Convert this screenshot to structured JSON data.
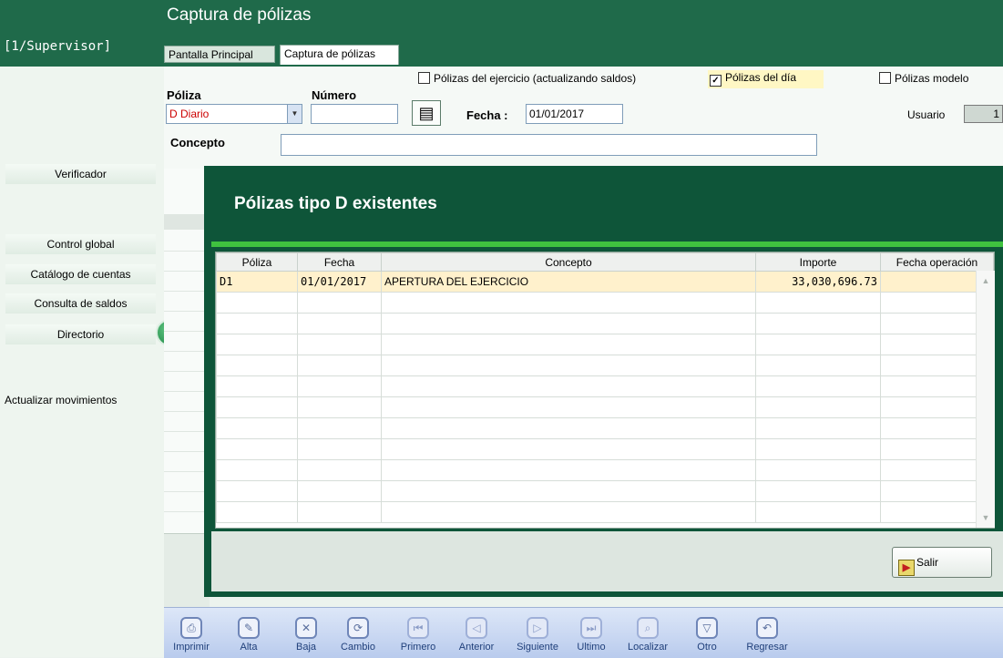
{
  "header": {
    "title": "Captura de pólizas",
    "user_tag": "[1/Supervisor]",
    "tabs": [
      "Pantalla Principal",
      "Captura de pólizas"
    ]
  },
  "sidebar": {
    "items": [
      "Verificador",
      "Control global",
      "Catálogo de cuentas",
      "Consulta de saldos",
      "Directorio"
    ],
    "actualizar_label": "Actualizar movimientos"
  },
  "form": {
    "chk_ejercicio": "Pólizas del ejercicio (actualizando saldos)",
    "chk_dia": "Pólizas del día",
    "chk_dia_checked": true,
    "chk_modelo": "Pólizas modelo",
    "poliza_label": "Póliza",
    "poliza_value": "D Diario",
    "numero_label": "Número",
    "numero_value": "",
    "fecha_label": "Fecha :",
    "fecha_value": "01/01/2017",
    "usuario_label": "Usuario",
    "usuario_value": "1",
    "concepto_label": "Concepto",
    "concepto_value": ""
  },
  "dialog": {
    "title": "Pólizas tipo D existentes",
    "columns": [
      "Póliza",
      "Fecha",
      "Concepto",
      "Importe",
      "Fecha operación"
    ],
    "rows": [
      {
        "poliza": "D1",
        "fecha": "01/01/2017",
        "concepto": "APERTURA DEL EJERCICIO",
        "importe": "33,030,696.73",
        "fecha_operacion": ""
      }
    ],
    "empty_rows": 11,
    "salir_label": "Salir"
  },
  "toolbar": {
    "items": [
      {
        "label": "Imprimir",
        "icon": "print-icon",
        "glyph": "⎙",
        "enabled": true
      },
      {
        "label": "Alta",
        "icon": "add-icon",
        "glyph": "✎",
        "enabled": true
      },
      {
        "label": "Baja",
        "icon": "delete-icon",
        "glyph": "✕",
        "enabled": true
      },
      {
        "label": "Cambio",
        "icon": "refresh-icon",
        "glyph": "⟳",
        "enabled": true
      },
      {
        "label": "Primero",
        "icon": "first-icon",
        "glyph": "⏮",
        "enabled": false
      },
      {
        "label": "Anterior",
        "icon": "previous-icon",
        "glyph": "◁",
        "enabled": false
      },
      {
        "label": "Siguiente",
        "icon": "next-icon",
        "glyph": "▷",
        "enabled": false
      },
      {
        "label": "Ultimo",
        "icon": "last-icon",
        "glyph": "⏭",
        "enabled": false
      },
      {
        "label": "Localizar",
        "icon": "search-icon",
        "glyph": "⌕",
        "enabled": false
      },
      {
        "label": "Otro",
        "icon": "other-icon",
        "glyph": "▽",
        "enabled": true
      },
      {
        "label": "Regresar",
        "icon": "undo-icon",
        "glyph": "↶",
        "enabled": true
      }
    ]
  },
  "colors": {
    "header_green": "#1f6a4a",
    "dialog_green": "#0e5539",
    "accent_green": "#3fc23f",
    "selected_row": "#fff1cc",
    "poliza_text": "#cc0000"
  }
}
